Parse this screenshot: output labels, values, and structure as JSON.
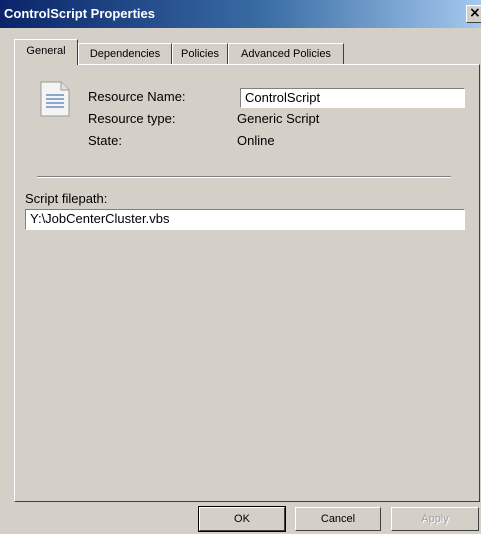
{
  "window": {
    "title": "ControlScript Properties"
  },
  "tabs": [
    {
      "label": "General",
      "active": true
    },
    {
      "label": "Dependencies",
      "active": false
    },
    {
      "label": "Policies",
      "active": false
    },
    {
      "label": "Advanced Policies",
      "active": false
    }
  ],
  "general": {
    "icon": "script-resource-icon",
    "resource_name_label": "Resource Name:",
    "resource_name_value": "ControlScript",
    "resource_type_label": "Resource type:",
    "resource_type_value": "Generic Script",
    "state_label": "State:",
    "state_value": "Online",
    "script_filepath_label": "Script filepath:",
    "script_filepath_value": "Y:\\JobCenterCluster.vbs"
  },
  "buttons": {
    "ok": "OK",
    "cancel": "Cancel",
    "apply": "Apply"
  },
  "colors": {
    "title_bar_start": "#0a246a",
    "title_bar_end": "#a6caf0",
    "dialog_bg": "#d4d0c8"
  }
}
